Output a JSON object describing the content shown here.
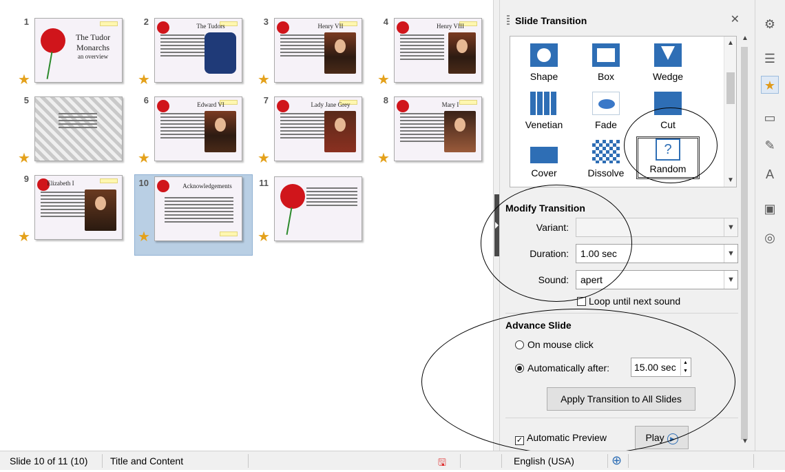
{
  "slides": [
    {
      "num": "1",
      "title": "The Tudor Monarchs",
      "subtitle": "an overview"
    },
    {
      "num": "2",
      "title": "The Tudors"
    },
    {
      "num": "3",
      "title": "Henry VII"
    },
    {
      "num": "4",
      "title": "Henry VIII"
    },
    {
      "num": "5",
      "title": ""
    },
    {
      "num": "6",
      "title": "Edward VI"
    },
    {
      "num": "7",
      "title": "Lady Jane Grey"
    },
    {
      "num": "8",
      "title": "Mary I"
    },
    {
      "num": "9",
      "title": "Elizabeth I"
    },
    {
      "num": "10",
      "title": "Acknowledgements"
    },
    {
      "num": "11",
      "title": ""
    }
  ],
  "panel": {
    "title": "Slide Transition",
    "transitions": [
      {
        "label": "Shape",
        "icon": "shape-icon"
      },
      {
        "label": "Box",
        "icon": "box-icon"
      },
      {
        "label": "Wedge",
        "icon": "wedge-icon"
      },
      {
        "label": "Venetian",
        "icon": "venetian-icon"
      },
      {
        "label": "Fade",
        "icon": "fade-icon"
      },
      {
        "label": "Cut",
        "icon": "cut-icon"
      },
      {
        "label": "Cover",
        "icon": "cover-icon"
      },
      {
        "label": "Dissolve",
        "icon": "dissolve-icon"
      },
      {
        "label": "Random",
        "icon": "random-icon",
        "glyph": "?"
      }
    ],
    "modify": {
      "title": "Modify Transition",
      "variant_label": "Variant:",
      "variant_value": "",
      "duration_label": "Duration:",
      "duration_value": "1.00 sec",
      "sound_label": "Sound:",
      "sound_value": "apert",
      "loop_label": "Loop until next sound"
    },
    "advance": {
      "title": "Advance Slide",
      "on_click_label": "On mouse click",
      "auto_label": "Automatically after:",
      "auto_value": "15.00 sec",
      "apply_all_label": "Apply Transition to All Slides"
    },
    "preview": {
      "auto_preview_label": "Automatic Preview",
      "auto_preview_checked": "✓",
      "play_label": "Play"
    }
  },
  "status": {
    "slide_info": "Slide 10 of 11 (10)",
    "layout": "Title and Content",
    "language": "English (USA)"
  },
  "colors": {
    "accent": "#2e6eb5",
    "selection": "#b9cfe4",
    "star": "#e4a11b"
  }
}
